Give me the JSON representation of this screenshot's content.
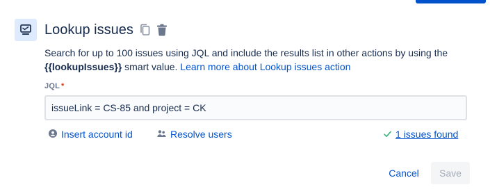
{
  "header": {
    "title": "Lookup issues",
    "icons": [
      "monitor-icon",
      "copy-icon",
      "trash-icon"
    ]
  },
  "description": {
    "text_before": "Search for up to 100 issues using JQL and include the results list in other actions by using the ",
    "smart_value": "{{lookupIssues}}",
    "text_after": " smart value. ",
    "link": "Learn more about Lookup issues action"
  },
  "jql": {
    "label": "JQL",
    "required_marker": "*",
    "value": "issueLink = CS-85 and project = CK"
  },
  "helpers": {
    "insert_account": "Insert account id",
    "resolve_users": "Resolve users",
    "issues_found": "1 issues found"
  },
  "buttons": {
    "cancel": "Cancel",
    "save": "Save"
  },
  "colors": {
    "primary": "#0052cc",
    "success": "#36b37e",
    "icon_bg": "#deebff",
    "required": "#de350b"
  }
}
